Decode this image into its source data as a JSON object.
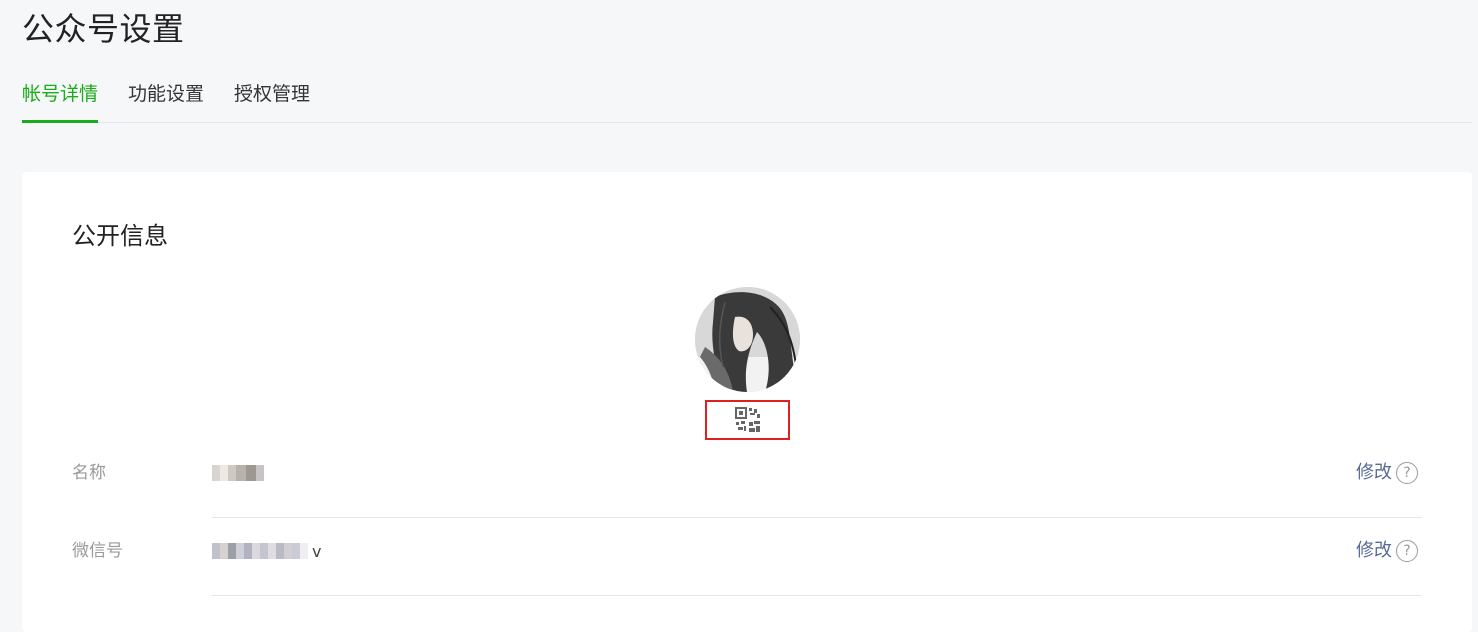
{
  "page": {
    "title": "公众号设置"
  },
  "tabs": [
    {
      "label": "帐号详情",
      "active": true
    },
    {
      "label": "功能设置",
      "active": false
    },
    {
      "label": "授权管理",
      "active": false
    }
  ],
  "public_info": {
    "section_title": "公开信息",
    "avatar": {
      "icon": "avatar-image"
    },
    "qr_code": {
      "icon": "qrcode-icon",
      "highlight_color": "#e02020"
    },
    "rows": [
      {
        "label": "名称",
        "value_blurred": true,
        "value_suffix": "",
        "action_label": "修改",
        "help_icon": "?"
      },
      {
        "label": "微信号",
        "value_blurred": true,
        "value_suffix": "v",
        "action_label": "修改",
        "help_icon": "?"
      }
    ]
  },
  "colors": {
    "accent": "#1aad19",
    "link": "#576b95",
    "label": "#9a9a9a"
  }
}
